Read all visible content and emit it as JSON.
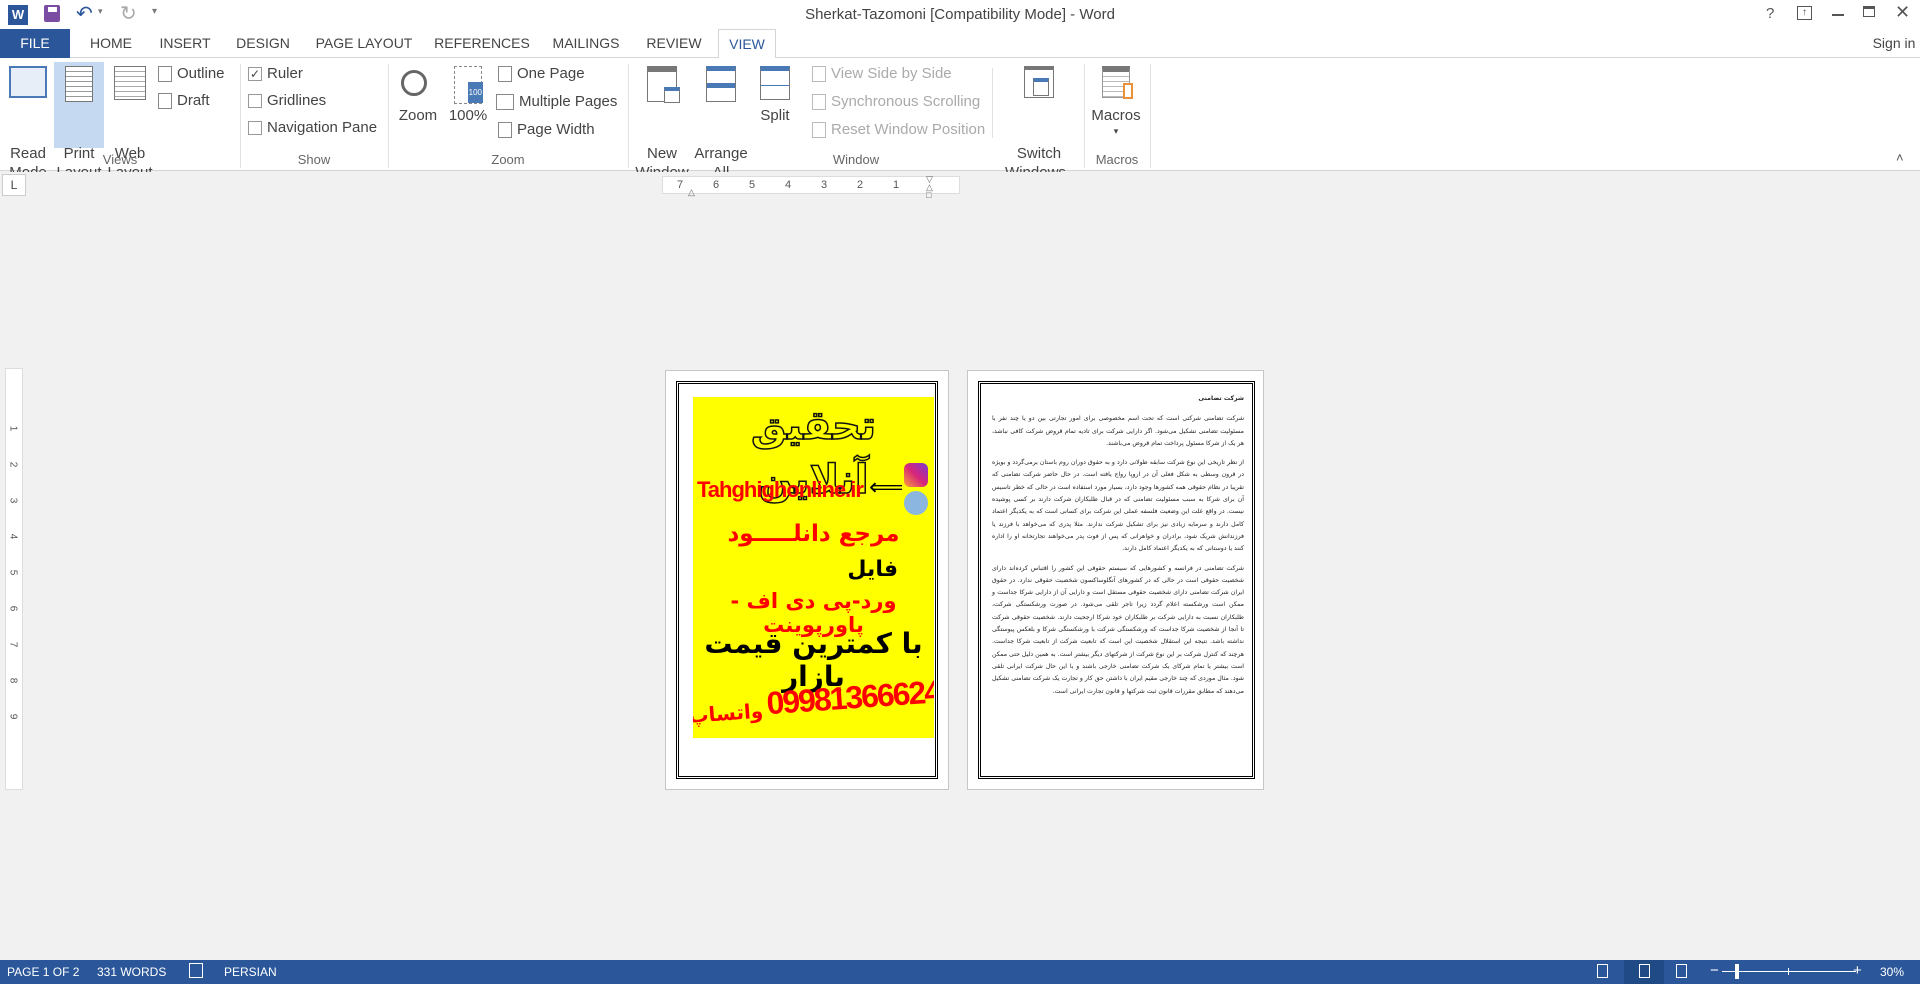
{
  "titlebar": {
    "title": "Sherkat-Tazomoni [Compatibility Mode] - Word",
    "help": "?",
    "qat": [
      "save-icon",
      "undo-icon",
      "redo-icon",
      "customize-icon"
    ]
  },
  "tabs": [
    {
      "label": "FILE"
    },
    {
      "label": "HOME"
    },
    {
      "label": "INSERT"
    },
    {
      "label": "DESIGN"
    },
    {
      "label": "PAGE LAYOUT"
    },
    {
      "label": "REFERENCES"
    },
    {
      "label": "MAILINGS"
    },
    {
      "label": "REVIEW"
    },
    {
      "label": "VIEW",
      "active": true
    }
  ],
  "sign_in": "Sign in",
  "ribbon": {
    "views": {
      "label": "Views",
      "read_mode": "Read\nMode",
      "print_layout": "Print\nLayout",
      "web_layout": "Web\nLayout",
      "outline": "Outline",
      "draft": "Draft"
    },
    "show": {
      "label": "Show",
      "ruler": "Ruler",
      "ruler_checked": true,
      "gridlines": "Gridlines",
      "gridlines_checked": false,
      "nav_pane": "Navigation Pane",
      "nav_pane_checked": false
    },
    "zoom": {
      "label": "Zoom",
      "zoom": "Zoom",
      "hundred": "100%",
      "hundred_badge": "100",
      "one_page": "One Page",
      "multiple_pages": "Multiple Pages",
      "page_width": "Page Width"
    },
    "window": {
      "label": "Window",
      "new_window": "New\nWindow",
      "arrange_all": "Arrange\nAll",
      "split": "Split",
      "side_by_side": "View Side by Side",
      "sync_scroll": "Synchronous Scrolling",
      "reset_pos": "Reset Window Position",
      "switch_windows": "Switch\nWindows"
    },
    "macros": {
      "label": "Macros",
      "macros": "Macros"
    }
  },
  "ruler": {
    "numbers": [
      "7",
      "6",
      "5",
      "4",
      "3",
      "2",
      "1"
    ],
    "vnumbers": [
      "1",
      "2",
      "3",
      "4",
      "5",
      "6",
      "7",
      "8",
      "9"
    ],
    "tab_selector": "L"
  },
  "page1": {
    "title": "تحقیق آنلاین",
    "site": "Tahghighonline.ir",
    "ref": "مرجع دانلـــــود",
    "file": "فایل",
    "formats": "ورد-پی دی اف - پاورپوینت",
    "price": "با کمترین قیمت بازار",
    "phone": "09981366624",
    "whatsapp": "واتساپ",
    "bg_color": "#ffff00",
    "red": "#ff0000"
  },
  "page2": {
    "heading": "شرکت تضامنی",
    "paragraphs": [
      "شرکت تضامنی شرکتی است که تحت اسم مخصوصی برای امور تجارتی بین دو یا چند نفر با مسئولیت تضامنی تشکیل می‌شود. اگر دارایی شرکت برای تادیه تمام قروض شرکت کافی نباشد، هر یک از شرکا مسئول پرداخت تمام قروض می‌باشند.",
      "از نظر تاریخی این نوع شرکت سابقه طولانی دارد و به حقوق دوران روم باستان برمی‌گردد و بویژه در قرون وسطی به شکل فعلی آن در اروپا رواج یافته است. در حال حاضر شرکت تضامنی که تقریبا در نظام حقوقی همه کشورها وجود دارد، بسیار مورد استفاده است در حالی که خطر تاسیس آن برای شرکا به سبب مسئولیت تضامنی که در قبال طلبکاران شرکت دارند بر کسی پوشیده نیست. در واقع علت این وضعیت فلسفه عملی این شرکت برای کسانی است که به یکدیگر اعتماد کامل دارند و سرمایه زیادی نیز برای تشکیل شرکت ندارند. مثلا پدری که می‌خواهد با فرزند یا فرزندانش شریک شود، برادران و خواهرانی که پس از فوت پدر می‌خواهند تجارتخانه او را اداره کنند یا دوستانی که به یکدیگر اعتماد کامل دارند.",
      "شرکت تضامنی در فرانسه و کشورهایی که سیستم حقوقی این کشور را اقتباس کرده‌اند دارای شخصیت حقوقی است در حالی که در کشورهای آنگلوساکسون شخصیت حقوقی ندارد. در حقوق ایران شرکت تضامنی دارای شخصیت حقوقی مستقل است و دارایی آن از دارایی شرکا جداست و ممکن است ورشکسته اعلام گردد زیرا تاجر تلقی می‌شود. در صورت ورشکستگی شرکت، طلبکاران نسبت به دارایی شرکت بر طلبکاران خود شرکا ارجحیت دارند. شخصیت حقوقی شرکت تا آنجا از شخصیت شرکا جداست که ورشکستگی شرکت با ورشکستگی شرکا و بلعکس پیوستگی نداشته باشد. نتیجه این استقلال شخصیت این است که تابعیت شرکت از تابعیت شرکا جداست. هرچند که کنترل شرکت بر این نوع شرکت از شرکتهای دیگر بیشتر است. به همین دلیل حتی ممکن است بیشتر یا تمام شرکای یک شرکت تضامنی خارجی باشند و با این حال شرکت ایرانی تلقی شود. مثال موردی که چند خارجی مقیم ایران با داشتن حق کار و تجارت یک شرکت تضامنی تشکیل می‌دهند که مطابق مقررات قانون ثبت شرکتها و قانون تجارت ایرانی است."
    ]
  },
  "status": {
    "page": "PAGE 1 OF 2",
    "words": "331 WORDS",
    "language": "PERSIAN",
    "zoom": "30%",
    "zoom_minus": "−",
    "zoom_plus": "+",
    "zoom_level_percent": 30
  }
}
